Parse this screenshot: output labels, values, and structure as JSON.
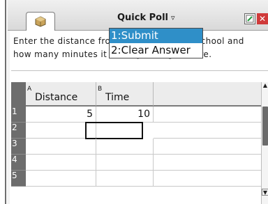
{
  "toolbar": {
    "menu_title": "Quick Poll",
    "menu_chevron": "▿",
    "close_glyph": "✕"
  },
  "dropdown": {
    "items": [
      {
        "label": "1:Submit",
        "selected": true
      },
      {
        "label": "2:Clear Answer",
        "selected": false
      }
    ]
  },
  "question": {
    "line1": "Enter the distance from home to Lincoln school and",
    "line2": "how many minutes it takes you to get there."
  },
  "sheet": {
    "columns": [
      {
        "letter": "A",
        "name": "Distance"
      },
      {
        "letter": "B",
        "name": "Time"
      },
      {
        "letter": "",
        "name": ""
      }
    ],
    "rows": [
      {
        "num": "1",
        "a": "5",
        "b": "10"
      },
      {
        "num": "2",
        "a": "",
        "b": ""
      },
      {
        "num": "3",
        "a": "",
        "b": ""
      },
      {
        "num": "4",
        "a": "",
        "b": ""
      },
      {
        "num": "5",
        "a": "",
        "b": ""
      }
    ]
  },
  "icons": {
    "document": "document-icon",
    "tool": "edit-tool-icon",
    "close": "close-icon"
  },
  "colors": {
    "selection": "#2f8fc8",
    "close": "#d03a3a"
  }
}
